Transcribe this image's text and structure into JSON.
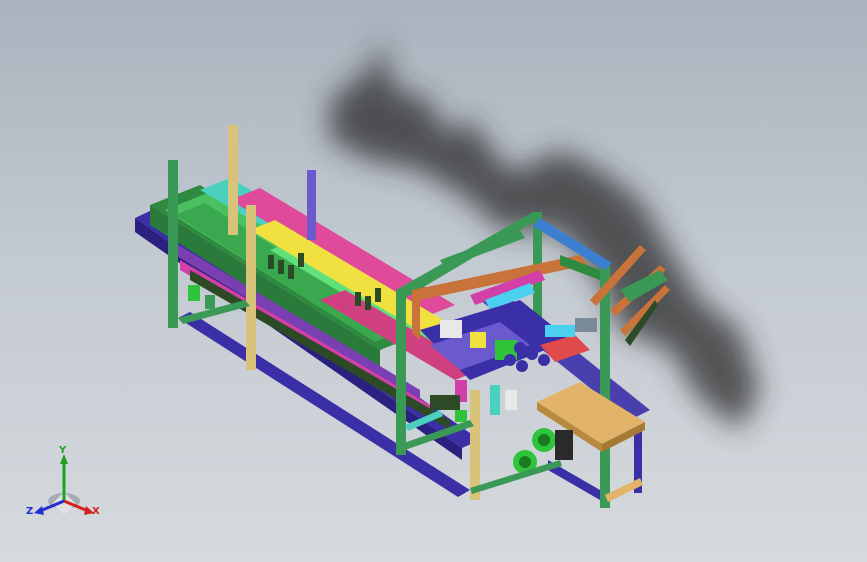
{
  "viewport": {
    "background_top": "#aab2bd",
    "background_bottom": "#d6dade"
  },
  "model": {
    "description_icon": "conveyor-machine-assembly",
    "colors": {
      "frame_green": "#3a9a55",
      "frame_tan": "#d9c27a",
      "frame_purple": "#3b2fa8",
      "frame_orange": "#c8733a",
      "table_tan": "#e2b46a",
      "motor_green": "#2fc43a",
      "shadow": "#2b2b2b"
    }
  },
  "triad": {
    "x_label": "X",
    "y_label": "Y",
    "z_label": "Z",
    "x_color": "#d42020",
    "y_color": "#20a020",
    "z_color": "#2030d0"
  }
}
